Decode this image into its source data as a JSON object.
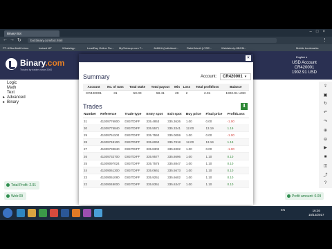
{
  "browser": {
    "tab_title": "Binary Bot",
    "url": "bot.binary.com/bot.html",
    "bookmarks": [
      "PT. AStonMulti Intern",
      "Instant MT",
      "WhatsApp",
      "LeadDay Online Fia...",
      "MyClubsup.com T...",
      "JAMKA (Individual...",
      "Rafat Monit (LYRE...",
      "Weblatenly-HBGM...",
      "Mobile bookmarks"
    ]
  },
  "site": {
    "logo_main": "Binary",
    "logo_suffix": ".com",
    "tagline": "Trusted by traders since 2000",
    "language": "English",
    "account_title": "USD Account",
    "account_id": "CR420001",
    "account_balance": "1902.91 USD"
  },
  "blocks_menu": [
    {
      "label": "Logic",
      "has_caret": false
    },
    {
      "label": "Math",
      "has_caret": false
    },
    {
      "label": "Text",
      "has_caret": false
    },
    {
      "label": "Advanced",
      "has_caret": true
    },
    {
      "label": "Binary",
      "has_caret": true
    }
  ],
  "toolbar_icons": [
    "upload-icon",
    "save-icon",
    "reset-icon",
    "undo-icon",
    "redo-icon",
    "zoom-in-icon",
    "zoom-out-icon",
    "run-icon",
    "stop-icon",
    "chart-icon",
    "trading-view-icon",
    "help-icon"
  ],
  "toolbar_glyphs": [
    "⇪",
    "▣",
    "↻",
    "↶",
    "↷",
    "⊕",
    "⊖",
    "▶",
    "■",
    "◫",
    "⤴",
    "?"
  ],
  "dialog": {
    "summary_title": "Summary",
    "account_label": "Account:",
    "account_value": "CR420001",
    "summary_headers": [
      "Account",
      "No. of runs",
      "Total stake",
      "Total payout",
      "Win",
      "Loss",
      "Total profit/loss",
      "Balance"
    ],
    "summary_rows": [
      [
        "CR420001",
        "31",
        "50.00",
        "58.41",
        "29",
        "2",
        "2.91",
        "1902.91 USD"
      ]
    ],
    "trades_title": "Trades",
    "trade_headers": [
      "Number",
      "Reference",
      "Trade type",
      "Entry spot",
      "Exit spot",
      "Buy price",
      "Final price",
      "Profit/Loss"
    ],
    "trade_rows": [
      [
        "31",
        "41309776800",
        "DIGITDIFF",
        "335.4853",
        "335.3626",
        "1.00",
        "0.00",
        "-1.00"
      ],
      [
        "30",
        "41309775840",
        "DIGITDIFF",
        "335.5571",
        "335.3341",
        "12.00",
        "13.19",
        "1.19"
      ],
      [
        "29",
        "41309751100",
        "DIGITDIFF",
        "335.7550",
        "335.0059",
        "1.00",
        "0.00",
        "-1.00"
      ],
      [
        "28",
        "41309748100",
        "DIGITDIFF",
        "335.6060",
        "335.7818",
        "12.00",
        "13.19",
        "1.19"
      ],
      [
        "27",
        "41309733840",
        "DIGITDIFF",
        "335.8302",
        "335.8302",
        "1.00",
        "0.00",
        "-1.00"
      ],
      [
        "26",
        "41309732700",
        "DIGITDIFF",
        "335.9577",
        "335.8696",
        "1.00",
        "1.10",
        "0.10"
      ],
      [
        "25",
        "41309097024",
        "DIGITDIFF",
        "335.7575",
        "335.8847",
        "1.00",
        "1.10",
        "0.10"
      ],
      [
        "24",
        "41309061300",
        "DIGITDIFF",
        "335.0661",
        "335.5673",
        "1.00",
        "1.10",
        "0.10"
      ],
      [
        "23",
        "41309051080",
        "DIGITDIFF",
        "335.9251",
        "335.6602",
        "1.00",
        "1.10",
        "0.10"
      ],
      [
        "22",
        "41309048000",
        "DIGITDIFF",
        "335.8351",
        "335.6347",
        "1.00",
        "1.10",
        "0.10"
      ]
    ]
  },
  "status": {
    "total_profit": "Total Profit: 2.91",
    "web": "Web:09",
    "profit_amount": "Profit amount: 0.09"
  },
  "taskbar": {
    "tray_text": "EN",
    "time": "16:26",
    "date": "15/12/2017"
  },
  "colors": {
    "brand_navy": "#2a3052",
    "brand_orange": "#e98024",
    "profit_green": "#2e8836",
    "loss_red": "#d13c36"
  }
}
